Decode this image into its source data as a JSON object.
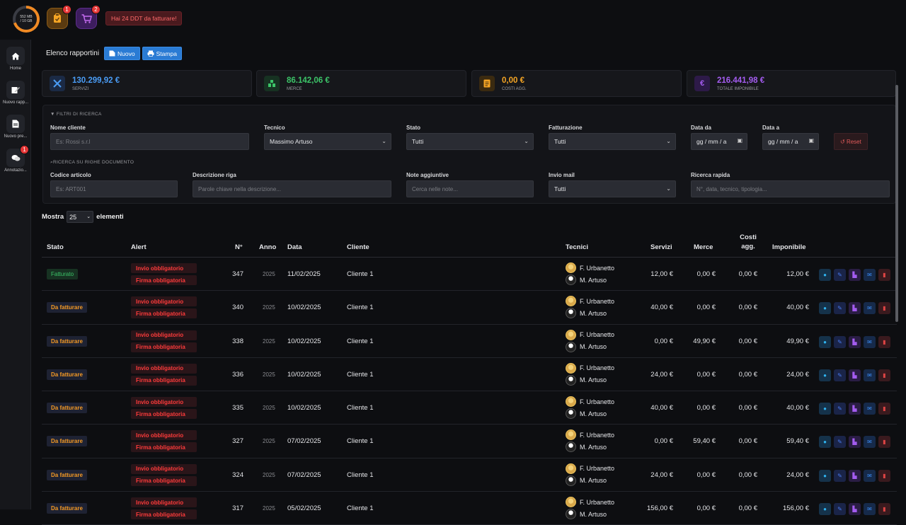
{
  "topbar": {
    "memory_used": "552 MB",
    "memory_total": "/ 10 GB",
    "clipboard_badge": "1",
    "cart_badge": "2",
    "alert_text": "Hai 24 DDT da fatturare!"
  },
  "sidebar": {
    "items": [
      {
        "label": "Home",
        "icon": "home-icon"
      },
      {
        "label": "Nuovo rapp...",
        "icon": "edit-icon"
      },
      {
        "label": "Nuovo pre...",
        "icon": "document-icon"
      },
      {
        "label": "Annotazio...",
        "icon": "chat-icon",
        "badge": "1"
      }
    ]
  },
  "header": {
    "title": "Elenco rapportini",
    "new_label": "Nuovo",
    "print_label": "Stampa"
  },
  "stats": [
    {
      "value": "130.299,92 €",
      "label": "SERVIZI",
      "color": "#4a9cf5",
      "icon": "tools-icon"
    },
    {
      "value": "86.142,06 €",
      "label": "MERCE",
      "color": "#3cc468",
      "icon": "boxes-icon"
    },
    {
      "value": "0,00 €",
      "label": "COSTI AGG.",
      "color": "#f5a524",
      "icon": "receipt-icon"
    },
    {
      "value": "216.441,98 €",
      "label": "TOTALE IMPONIBILE",
      "color": "#a45cf0",
      "icon": "euro-icon"
    }
  ],
  "filters": {
    "title": "FILTRI DI RICERCA",
    "client_label": "Nome cliente",
    "client_placeholder": "Es: Rossi s.r.l",
    "tech_label": "Tecnico",
    "tech_value": "Massimo Artuso",
    "state_label": "Stato",
    "state_value": "Tutti",
    "billing_label": "Fatturazione",
    "billing_value": "Tutti",
    "date_from_label": "Data da",
    "date_from_value": "gg / mm / a",
    "date_to_label": "Data a",
    "date_to_value": "gg / mm / a",
    "reset_label": "Reset",
    "rows_title": "RICERCA SU RIGHE DOCUMENTO",
    "code_label": "Codice articolo",
    "code_placeholder": "Es: ART001",
    "desc_label": "Descrizione riga",
    "desc_placeholder": "Parole chiave nella descrizione...",
    "notes_label": "Note aggiuntive",
    "notes_placeholder": "Cerca nelle note...",
    "mail_label": "Invio mail",
    "mail_value": "Tutti",
    "quick_label": "Ricerca rapida",
    "quick_placeholder": "N°, data, tecnico, tipologia..."
  },
  "show": {
    "prefix": "Mostra",
    "value": "25",
    "suffix": "elementi"
  },
  "table": {
    "headers": {
      "stato": "Stato",
      "alert": "Alert",
      "num": "N°",
      "anno": "Anno",
      "data": "Data",
      "cliente": "Cliente",
      "tecnici": "Tecnici",
      "servizi": "Servizi",
      "merce": "Merce",
      "costi": "Costi agg.",
      "imponibile": "Imponibile"
    },
    "alert1": "Invio obbligatorio",
    "alert2": "Firma obbligatoria",
    "tech1": "F. Urbanetto",
    "tech2": "M. Artuso",
    "rows": [
      {
        "stato": "Fatturato",
        "kind": "ok",
        "num": "347",
        "anno": "2025",
        "data": "11/02/2025",
        "cliente": "Cliente 1",
        "servizi": "12,00 €",
        "merce": "0,00 €",
        "costi": "0,00 €",
        "imponibile": "12,00 €"
      },
      {
        "stato": "Da fatturare",
        "kind": "todo",
        "num": "340",
        "anno": "2025",
        "data": "10/02/2025",
        "cliente": "Cliente 1",
        "servizi": "40,00 €",
        "merce": "0,00 €",
        "costi": "0,00 €",
        "imponibile": "40,00 €"
      },
      {
        "stato": "Da fatturare",
        "kind": "todo",
        "num": "338",
        "anno": "2025",
        "data": "10/02/2025",
        "cliente": "Cliente 1",
        "servizi": "0,00 €",
        "merce": "49,90 €",
        "costi": "0,00 €",
        "imponibile": "49,90 €"
      },
      {
        "stato": "Da fatturare",
        "kind": "todo",
        "num": "336",
        "anno": "2025",
        "data": "10/02/2025",
        "cliente": "Cliente 1",
        "servizi": "24,00 €",
        "merce": "0,00 €",
        "costi": "0,00 €",
        "imponibile": "24,00 €"
      },
      {
        "stato": "Da fatturare",
        "kind": "todo",
        "num": "335",
        "anno": "2025",
        "data": "10/02/2025",
        "cliente": "Cliente 1",
        "servizi": "40,00 €",
        "merce": "0,00 €",
        "costi": "0,00 €",
        "imponibile": "40,00 €"
      },
      {
        "stato": "Da fatturare",
        "kind": "todo",
        "num": "327",
        "anno": "2025",
        "data": "07/02/2025",
        "cliente": "Cliente 1",
        "servizi": "0,00 €",
        "merce": "59,40 €",
        "costi": "0,00 €",
        "imponibile": "59,40 €"
      },
      {
        "stato": "Da fatturare",
        "kind": "todo",
        "num": "324",
        "anno": "2025",
        "data": "07/02/2025",
        "cliente": "Cliente 1",
        "servizi": "24,00 €",
        "merce": "0,00 €",
        "costi": "0,00 €",
        "imponibile": "24,00 €"
      },
      {
        "stato": "Da fatturare",
        "kind": "todo",
        "num": "317",
        "anno": "2025",
        "data": "05/02/2025",
        "cliente": "Cliente 1",
        "servizi": "156,00 €",
        "merce": "0,00 €",
        "costi": "0,00 €",
        "imponibile": "156,00 €"
      }
    ]
  }
}
